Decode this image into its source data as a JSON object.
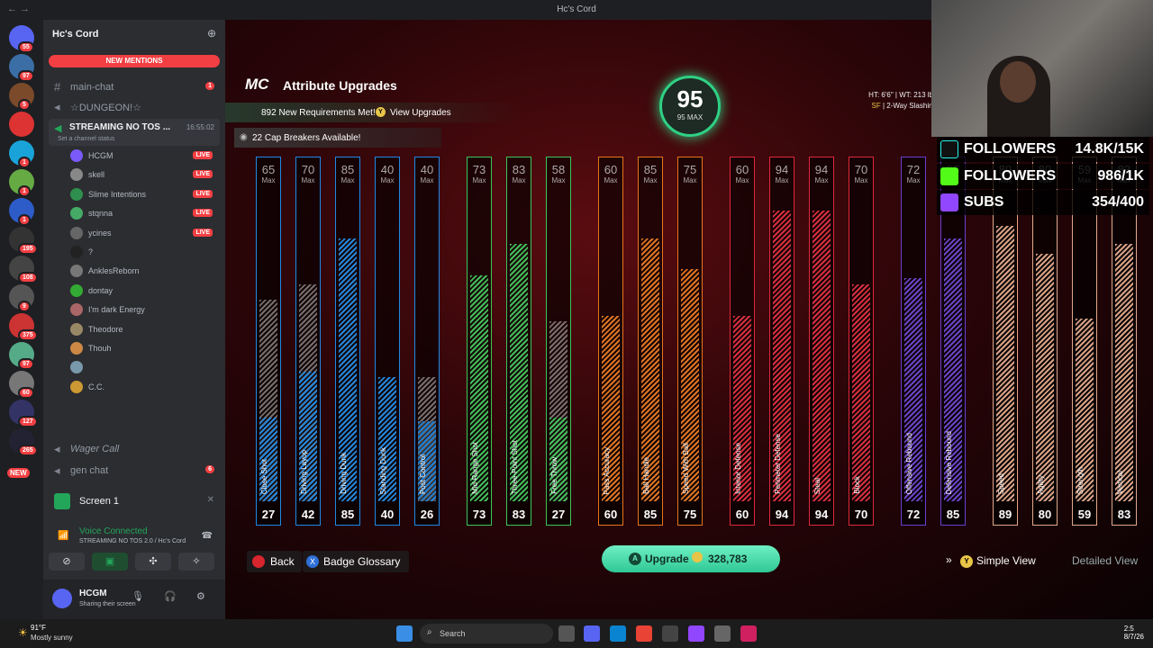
{
  "window": {
    "title": "Hc's Cord"
  },
  "server_rail": {
    "servers": [
      {
        "badge": "55"
      },
      {
        "badge": "97"
      },
      {
        "badge": "5"
      },
      {
        "badge": ""
      },
      {
        "badge": "1"
      },
      {
        "badge": "1"
      },
      {
        "badge": "1"
      },
      {
        "badge": "195"
      },
      {
        "badge": "108"
      },
      {
        "badge": "9"
      },
      {
        "badge": "375"
      },
      {
        "badge": "97"
      },
      {
        "badge": "60"
      },
      {
        "badge": "127"
      },
      {
        "badge": "265"
      }
    ],
    "new_label": "NEW"
  },
  "sidebar": {
    "server_name": "Hc's Cord",
    "new_mentions": "NEW MENTIONS",
    "channels": [
      {
        "label": "main-chat",
        "badge": "1"
      },
      {
        "label": "☆DUNGEON!☆",
        "badge": ""
      }
    ],
    "voice_channel": {
      "label": "STREAMING NO TOS ...",
      "timer": "16:55:02",
      "status": "Set a channel status"
    },
    "members": [
      {
        "name": "HCGM",
        "live": "LIVE",
        "color": "#7a5af8"
      },
      {
        "name": "skell",
        "live": "LIVE",
        "color": "#888"
      },
      {
        "name": "Slime Intentions",
        "live": "LIVE",
        "color": "#2f8f4e"
      },
      {
        "name": "stqnna",
        "live": "LIVE",
        "color": "#4a6"
      },
      {
        "name": "ycines",
        "live": "LIVE",
        "color": "#666"
      },
      {
        "name": "?",
        "live": "",
        "color": "#222"
      },
      {
        "name": "AnklesReborn",
        "live": "",
        "color": "#777"
      },
      {
        "name": "dontay",
        "live": "",
        "color": "#3a3"
      },
      {
        "name": "I'm dark Energy",
        "live": "",
        "color": "#a66"
      },
      {
        "name": "Theodore",
        "live": "",
        "color": "#986"
      },
      {
        "name": "Thouh",
        "live": "",
        "color": "#c84"
      },
      {
        "name": "",
        "live": "",
        "color": "#79a"
      },
      {
        "name": "C.C.",
        "live": "",
        "color": "#c93"
      }
    ],
    "wager_call": "Wager Call",
    "gen_chat": "gen chat",
    "gen_chat_badge": "6",
    "screen_share": "Screen 1",
    "voice_connected": "Voice Connected",
    "voice_channel_path": "STREAMING NO TOS 2.0 / Hc's Cord",
    "user": {
      "name": "HCGM",
      "status": "Sharing their screen"
    }
  },
  "game": {
    "title": "Attribute Upgrades",
    "requirements": "892 New Requirements Met!",
    "view_upgrades": "View Upgrades",
    "cap_breakers": "22 Cap Breakers Available!",
    "overall": "95",
    "overall_max": "95 MAX",
    "player_info": {
      "height": "HT: 6'6\"",
      "weight": "WT: 213 lbs",
      "position": "SF",
      "archetype": "2-Way Slashing"
    },
    "max_label": "Max",
    "attributes": [
      {
        "name": "Close Shot",
        "current": 27,
        "max": 65,
        "group": "outside"
      },
      {
        "name": "Driving Layup",
        "current": 42,
        "max": 70,
        "group": "outside"
      },
      {
        "name": "Driving Dunk",
        "current": 85,
        "max": 85,
        "group": "outside"
      },
      {
        "name": "Standing Dunk",
        "current": 40,
        "max": 40,
        "group": "outside"
      },
      {
        "name": "Post Control",
        "current": 26,
        "max": 40,
        "group": "outside"
      },
      {
        "name": "Mid-Range Shot",
        "current": 73,
        "max": 73,
        "group": "shooting"
      },
      {
        "name": "Three-Point Shot",
        "current": 83,
        "max": 83,
        "group": "shooting"
      },
      {
        "name": "Free Throw",
        "current": 27,
        "max": 58,
        "group": "shooting"
      },
      {
        "name": "Pass Accuracy",
        "current": 60,
        "max": 60,
        "group": "playmaking"
      },
      {
        "name": "Ball Handle",
        "current": 85,
        "max": 85,
        "group": "playmaking"
      },
      {
        "name": "Speed With Ball",
        "current": 75,
        "max": 75,
        "group": "playmaking"
      },
      {
        "name": "Interior Defense",
        "current": 60,
        "max": 60,
        "group": "defense"
      },
      {
        "name": "Perimeter Defense",
        "current": 94,
        "max": 94,
        "group": "defense"
      },
      {
        "name": "Steal",
        "current": 94,
        "max": 94,
        "group": "defense"
      },
      {
        "name": "Block",
        "current": 70,
        "max": 70,
        "group": "defense"
      },
      {
        "name": "Offensive Rebound",
        "current": 72,
        "max": 72,
        "group": "rebounding"
      },
      {
        "name": "Defensive Rebound",
        "current": 85,
        "max": 85,
        "group": "rebounding"
      },
      {
        "name": "Speed",
        "current": 89,
        "max": 89,
        "group": "physical"
      },
      {
        "name": "Agility",
        "current": 80,
        "max": 80,
        "group": "physical"
      },
      {
        "name": "Strength",
        "current": 59,
        "max": 59,
        "group": "physical"
      },
      {
        "name": "Vertical",
        "current": 83,
        "max": 83,
        "group": "physical"
      }
    ],
    "groups": {
      "outside": "#1e88e5",
      "shooting": "#3ec45a",
      "playmaking": "#e8741c",
      "defense": "#e0283a",
      "rebounding": "#6a3fd0",
      "physical": "#e2a889"
    },
    "back": "Back",
    "badge_glossary": "Badge Glossary",
    "upgrade": "Upgrade",
    "upgrade_cost": "328,783",
    "simple_view": "Simple View",
    "detailed_view": "Detailed View"
  },
  "stream_overlay": {
    "tiktok": {
      "label": "FOLLOWERS",
      "value": "14.8K/15K"
    },
    "kick": {
      "label": "FOLLOWERS",
      "value": "986/1K"
    },
    "twitch": {
      "label": "SUBS",
      "value": "354/400"
    }
  },
  "taskbar": {
    "temp": "91°F",
    "condition": "Mostly sunny",
    "search": "Search",
    "time": "2:5",
    "date": "8/7/26"
  }
}
